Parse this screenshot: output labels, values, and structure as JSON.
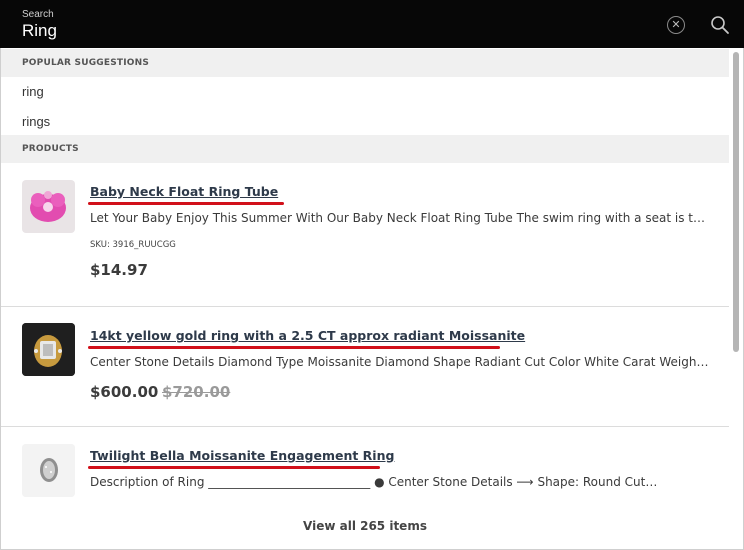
{
  "search": {
    "label": "Search",
    "value": "Ring",
    "clear_icon": "close-icon",
    "search_icon": "search-icon"
  },
  "suggestions": {
    "header": "POPULAR SUGGESTIONS",
    "items": [
      {
        "label": "ring"
      },
      {
        "label": "rings"
      }
    ]
  },
  "products": {
    "header": "PRODUCTS",
    "items": [
      {
        "title": "Baby Neck Float Ring Tube",
        "description": "Let Your Baby Enjoy This Summer With Our Baby Neck Float Ring Tube The swim ring with a seat is the b…",
        "sku": "SKU: 3916_RUUCGG",
        "price": "$14.97"
      },
      {
        "title": "14kt yellow gold ring with a 2.5 CT approx radiant Moissanite",
        "description": "Center Stone Details Diamond Type Moissanite Diamond Shape Radiant Cut Color White Carat Weight 2.5…",
        "price": "$600.00",
        "old_price": "$720.00"
      },
      {
        "title": "Twilight Bella Moissanite Engagement Ring",
        "description": "Description of Ring ___________________________ ● Center Stone Details ⟶ Shape: Round Cut…"
      }
    ]
  },
  "footer": {
    "view_all": "View all 265 items"
  },
  "colors": {
    "header_bg": "#070707",
    "highlight_underline": "#d1101a",
    "section_bg": "#f0f0f0"
  }
}
